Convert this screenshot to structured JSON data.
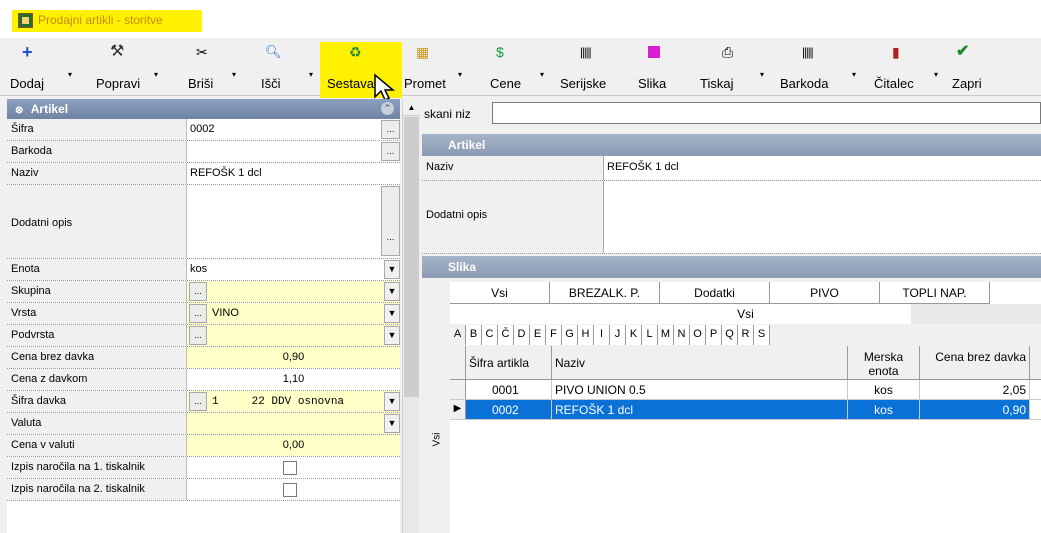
{
  "window": {
    "title": "Prodajni artikli - storitve"
  },
  "toolbar": {
    "buttons": [
      {
        "label": "Dodaj",
        "icon": "plus-icon"
      },
      {
        "label": "Popravi",
        "icon": "hammer-icon"
      },
      {
        "label": "Briši",
        "icon": "scissors-icon"
      },
      {
        "label": "Išči",
        "icon": "search-icon"
      },
      {
        "label": "Sestava",
        "icon": "recycle-icon"
      },
      {
        "label": "Promet",
        "icon": "traffic-icon"
      },
      {
        "label": "Cene",
        "icon": "dollar-icon"
      },
      {
        "label": "Serijske",
        "icon": "barcode-icon"
      },
      {
        "label": "Slika",
        "icon": "image-icon"
      },
      {
        "label": "Tiskaj",
        "icon": "printer-icon"
      },
      {
        "label": "Barkoda",
        "icon": "barcode-icon"
      },
      {
        "label": "Čitalec",
        "icon": "reader-icon"
      },
      {
        "label": "Zapri",
        "icon": "check-icon"
      }
    ]
  },
  "left_panel": {
    "header": "Artikel",
    "fields": {
      "sifra": {
        "label": "Šifra",
        "value": "0002"
      },
      "barkoda": {
        "label": "Barkoda",
        "value": ""
      },
      "naziv": {
        "label": "Naziv",
        "value": "REFOŠK 1 dcl"
      },
      "dodatni_opis": {
        "label": "Dodatni opis",
        "value": ""
      },
      "enota": {
        "label": "Enota",
        "value": "kos"
      },
      "skupina": {
        "label": "Skupina",
        "value": ""
      },
      "vrsta": {
        "label": "Vrsta",
        "value": "VINO"
      },
      "podvrsta": {
        "label": "Podvrsta",
        "value": ""
      },
      "cena_brez": {
        "label": "Cena brez davka",
        "value": "0,90"
      },
      "cena_z": {
        "label": "Cena z davkom",
        "value": "1,10"
      },
      "sifra_davka": {
        "label": "Šifra davka",
        "value": "1     22 DDV osnovna"
      },
      "valuta": {
        "label": "Valuta",
        "value": ""
      },
      "cena_valuti": {
        "label": "Cena v valuti",
        "value": "0,00"
      },
      "izpis1": {
        "label": "Izpis naročila na 1. tiskalnik"
      },
      "izpis2": {
        "label": "Izpis naročila na 2. tiskalnik"
      }
    }
  },
  "right_panel": {
    "search_label": "skani niz",
    "artikel_header": "Artikel",
    "naziv": {
      "label": "Naziv",
      "value": "REFOŠK 1 dcl"
    },
    "dodatni_opis": {
      "label": "Dodatni opis",
      "value": ""
    },
    "slika_header": "Slika",
    "side_label": "Vsi",
    "tabs": [
      "Vsi",
      "BREZALK. P.",
      "Dodatki",
      "PIVO",
      "TOPLI NAP."
    ],
    "vsi_bar": "Vsi",
    "letters": [
      "A",
      "B",
      "C",
      "Č",
      "D",
      "E",
      "F",
      "G",
      "H",
      "I",
      "J",
      "K",
      "L",
      "M",
      "N",
      "O",
      "P",
      "Q",
      "R",
      "S"
    ],
    "grid": {
      "headers": {
        "sifra": "Šifra artikla",
        "naziv": "Naziv",
        "enota": "Merska enota",
        "cena": "Cena brez davka"
      },
      "rows": [
        {
          "sifra": "0001",
          "naziv": "PIVO UNION 0.5",
          "enota": "kos",
          "cena": "2,05"
        },
        {
          "sifra": "0002",
          "naziv": "REFOŠK 1 dcl",
          "enota": "kos",
          "cena": "0,90"
        }
      ]
    }
  },
  "colors": {
    "highlight": "#fff100",
    "selection": "#0a72d7",
    "header": "#8b9ab3"
  }
}
